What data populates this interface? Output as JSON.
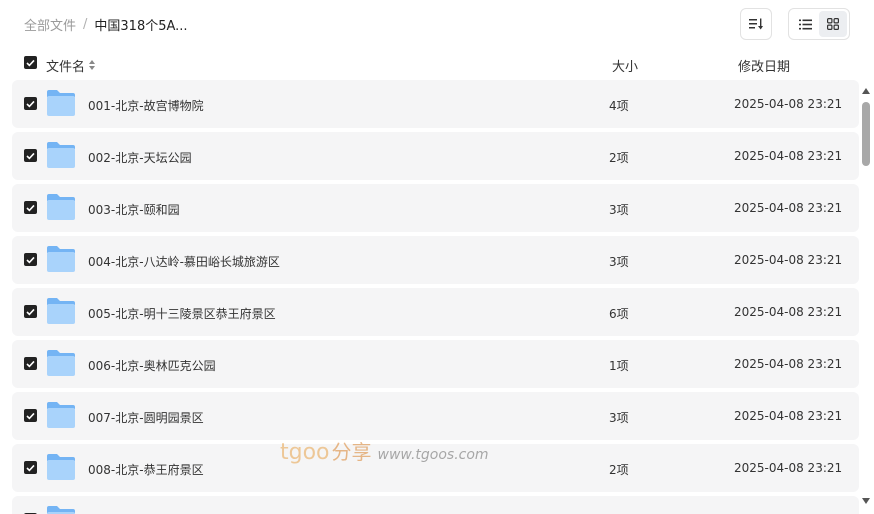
{
  "breadcrumb": {
    "root": "全部文件",
    "separator": "/",
    "current": "中国318个5A..."
  },
  "toolbar": {
    "sort_icon": "sort-list-icon",
    "list_view_icon": "list-view-icon",
    "grid_view_icon": "grid-view-icon",
    "active_view": "list"
  },
  "columns": {
    "name": "文件名",
    "size": "大小",
    "date": "修改日期"
  },
  "colors": {
    "row_bg": "#f5f5f6",
    "checkbox": "#222222",
    "folder_light": "#a9d3fb",
    "folder_dark": "#74b4f4",
    "scroll_thumb": "#a8a8a8"
  },
  "files": [
    {
      "name": "001-北京-故宫博物院",
      "size": "4项",
      "date": "2025-04-08 23:21",
      "checked": true
    },
    {
      "name": "002-北京-天坛公园",
      "size": "2项",
      "date": "2025-04-08 23:21",
      "checked": true
    },
    {
      "name": "003-北京-颐和园",
      "size": "3项",
      "date": "2025-04-08 23:21",
      "checked": true
    },
    {
      "name": "004-北京-八达岭-慕田峪长城旅游区",
      "size": "3项",
      "date": "2025-04-08 23:21",
      "checked": true
    },
    {
      "name": "005-北京-明十三陵景区恭王府景区",
      "size": "6项",
      "date": "2025-04-08 23:21",
      "checked": true
    },
    {
      "name": "006-北京-奥林匹克公园",
      "size": "1项",
      "date": "2025-04-08 23:21",
      "checked": true
    },
    {
      "name": "007-北京-圆明园景区",
      "size": "3项",
      "date": "2025-04-08 23:21",
      "checked": true
    },
    {
      "name": "008-北京-恭王府景区",
      "size": "2项",
      "date": "2025-04-08 23:21",
      "checked": true
    }
  ],
  "watermark": {
    "logo": "tgoo",
    "label": "分享",
    "url": "www.tgoos.com"
  }
}
